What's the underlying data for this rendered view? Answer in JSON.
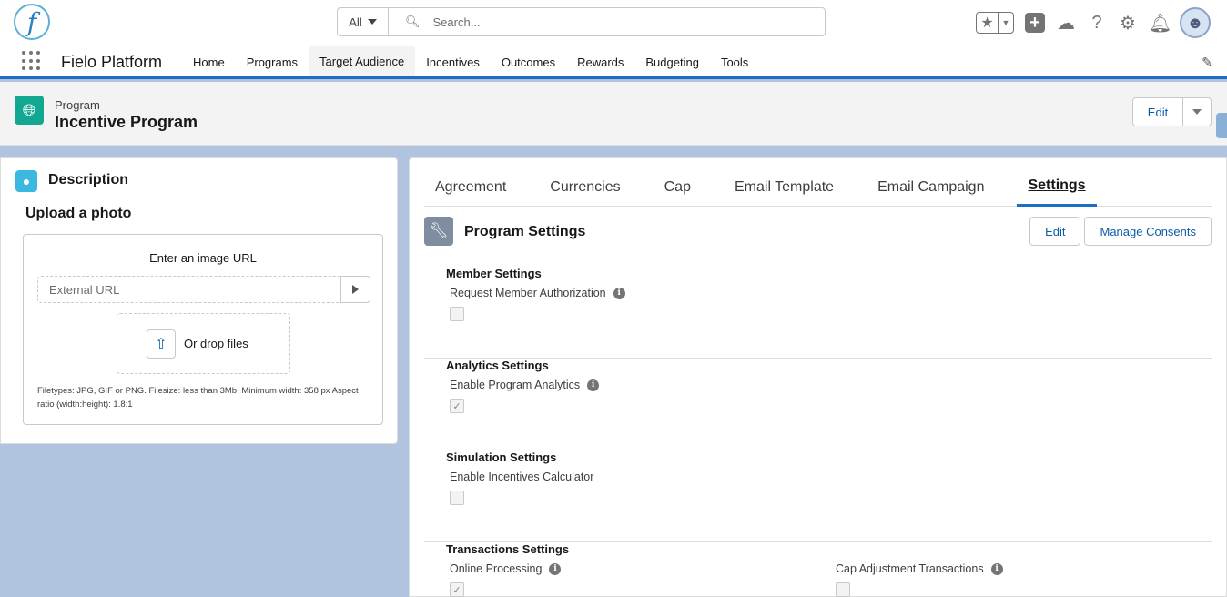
{
  "header": {
    "logo_letter": "f",
    "search_scope": "All",
    "search_placeholder": "Search...",
    "icons": [
      "favorites-star-icon",
      "add-icon",
      "trailhead-icon",
      "help-icon",
      "setup-gear-icon",
      "notifications-bell-icon",
      "user-avatar"
    ]
  },
  "nav": {
    "app_name": "Fielo Platform",
    "items": [
      "Home",
      "Programs",
      "Target Audience",
      "Incentives",
      "Outcomes",
      "Rewards",
      "Budgeting",
      "Tools"
    ],
    "active_item": "Target Audience",
    "accent_color": "#1b6fc2"
  },
  "record": {
    "object_type": "Program",
    "title": "Incentive Program",
    "edit_label": "Edit"
  },
  "description_card": {
    "title": "Description",
    "upload_title": "Upload a photo",
    "url_label": "Enter an image URL",
    "url_placeholder": "External URL",
    "drop_text": "Or drop files",
    "help_text": "Filetypes: JPG, GIF or PNG. Filesize: less than 3Mb. Minimum width: 358 px Aspect ratio (width:height): 1.8:1"
  },
  "tabs": {
    "items": [
      "Agreement",
      "Currencies",
      "Cap",
      "Email Template",
      "Email Campaign",
      "Settings"
    ],
    "active": "Settings"
  },
  "program_settings": {
    "title": "Program Settings",
    "edit_label": "Edit",
    "manage_consents_label": "Manage Consents",
    "sections": [
      {
        "heading": "Member Settings",
        "fields": [
          {
            "label": "Request Member Authorization",
            "info": true,
            "checked": false
          }
        ]
      },
      {
        "heading": "Analytics Settings",
        "fields": [
          {
            "label": "Enable Program Analytics",
            "info": true,
            "checked": true
          }
        ]
      },
      {
        "heading": "Simulation Settings",
        "fields": [
          {
            "label": "Enable Incentives Calculator",
            "info": false,
            "checked": false
          }
        ]
      },
      {
        "heading": "Transactions Settings",
        "fields": [
          {
            "label": "Online Processing",
            "info": true,
            "checked": true
          },
          {
            "label": "Cap Adjustment Transactions",
            "info": true,
            "checked": false
          }
        ]
      }
    ]
  }
}
